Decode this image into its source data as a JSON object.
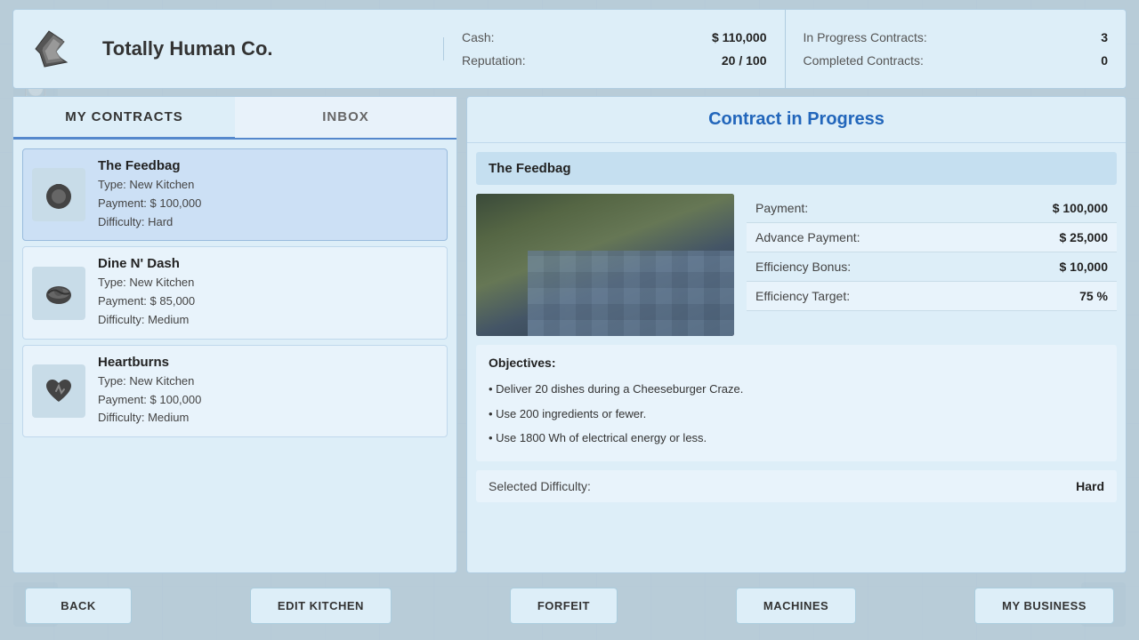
{
  "header": {
    "company_name": "Totally Human Co.",
    "stats": {
      "cash_label": "Cash:",
      "cash_value": "$ 110,000",
      "reputation_label": "Reputation:",
      "reputation_value": "20 / 100",
      "in_progress_label": "In Progress Contracts:",
      "in_progress_value": "3",
      "completed_label": "Completed Contracts:",
      "completed_value": "0"
    }
  },
  "left_panel": {
    "tabs": [
      {
        "id": "my-contracts",
        "label": "MY CONTRACTS",
        "active": true
      },
      {
        "id": "inbox",
        "label": "INBOX",
        "active": false
      }
    ],
    "contracts": [
      {
        "id": "feedbag",
        "name": "The Feedbag",
        "type": "Type: New Kitchen",
        "payment": "Payment: $ 100,000",
        "difficulty": "Difficulty: Hard",
        "icon": "🔒",
        "selected": true
      },
      {
        "id": "dine-n-dash",
        "name": "Dine N' Dash",
        "type": "Type: New Kitchen",
        "payment": "Payment: $ 85,000",
        "difficulty": "Difficulty: Medium",
        "icon": "🍔",
        "selected": false
      },
      {
        "id": "heartburns",
        "name": "Heartburns",
        "type": "Type: New Kitchen",
        "payment": "Payment: $ 100,000",
        "difficulty": "Difficulty: Medium",
        "icon": "💔",
        "selected": false
      }
    ]
  },
  "right_panel": {
    "title": "Contract in Progress",
    "contract_name": "The Feedbag",
    "financials": [
      {
        "label": "Payment:",
        "value": "$ 100,000"
      },
      {
        "label": "Advance Payment:",
        "value": "$ 25,000"
      },
      {
        "label": "Efficiency Bonus:",
        "value": "$ 10,000"
      },
      {
        "label": "Efficiency Target:",
        "value": "75 %"
      }
    ],
    "objectives_title": "Objectives:",
    "objectives": [
      "• Deliver 20 dishes during a Cheeseburger Craze.",
      "• Use 200 ingredients or fewer.",
      "• Use 1800 Wh of electrical energy or less."
    ],
    "difficulty_label": "Selected Difficulty:",
    "difficulty_value": "Hard"
  },
  "toolbar": {
    "buttons": [
      {
        "id": "back",
        "label": "BACK"
      },
      {
        "id": "edit-kitchen",
        "label": "EDIT KITCHEN"
      },
      {
        "id": "forfeit",
        "label": "FORFEIT"
      },
      {
        "id": "machines",
        "label": "MACHINES"
      },
      {
        "id": "my-business",
        "label": "MY BUSINESS"
      }
    ]
  }
}
